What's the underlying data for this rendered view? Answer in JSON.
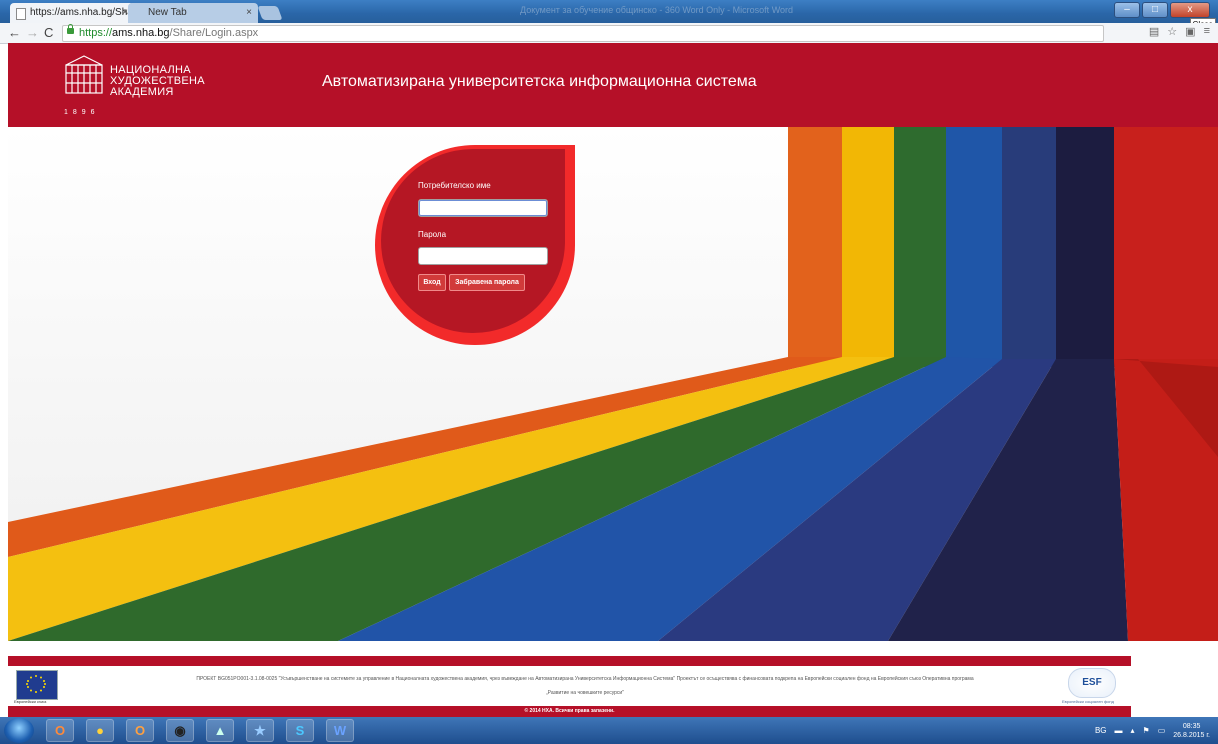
{
  "browser": {
    "tabs": [
      {
        "label": "https://ams.nha.bg/Share/",
        "close": "×"
      },
      {
        "label": "New Tab",
        "close": "×"
      }
    ],
    "window_title": "Документ за обучение общинско - 360 Word Only - Microsoft Word",
    "window_controls": {
      "minimize": "–",
      "maximize": "□",
      "close": "x",
      "close_tooltip": "Close"
    },
    "nav": {
      "back": "←",
      "forward": "→",
      "reload": "C"
    },
    "url": {
      "scheme": "https://",
      "host": "ams.nha.bg",
      "path": "/Share/Login.aspx"
    }
  },
  "header": {
    "logo_lines": [
      "НАЦИОНАЛНА",
      "ХУДОЖЕСТВЕНА",
      "АКАДЕМИЯ"
    ],
    "logo_year": "1896",
    "title": "Автоматизирана университетска информационна система",
    "background_color": "#b51028"
  },
  "login": {
    "username_label": "Потребителско име",
    "username_value": "",
    "password_label": "Парола",
    "password_value": "",
    "login_button": "Вход",
    "forgot_button": "Забравена парола"
  },
  "footer": {
    "eu_caption": "Европейски съюз",
    "eco_logo": "ESF",
    "eco_caption": "Европейски социален фонд",
    "project_line1": "ПРОЕКТ BG051PO001-3.1.08-0025 \"Усъвършенстване на системите за управление в Националната художествена академия, чрез въвеждане на Автоматизирана Университетска Информационна Система\" Проектът се осъществява с финансовата подкрепа на Европейски социален фонд на Европейския съюз Оперативна програма",
    "project_line2": "„Развитие на човешките ресурси\"",
    "copyright": "© 2014 НХА. Всички права запазени."
  },
  "taskbar": {
    "apps": [
      "O",
      "●",
      "O",
      "◉",
      "▲",
      "★",
      "S",
      "W"
    ],
    "lang": "BG",
    "time": "08:35",
    "date": "26.8.2015 г."
  }
}
